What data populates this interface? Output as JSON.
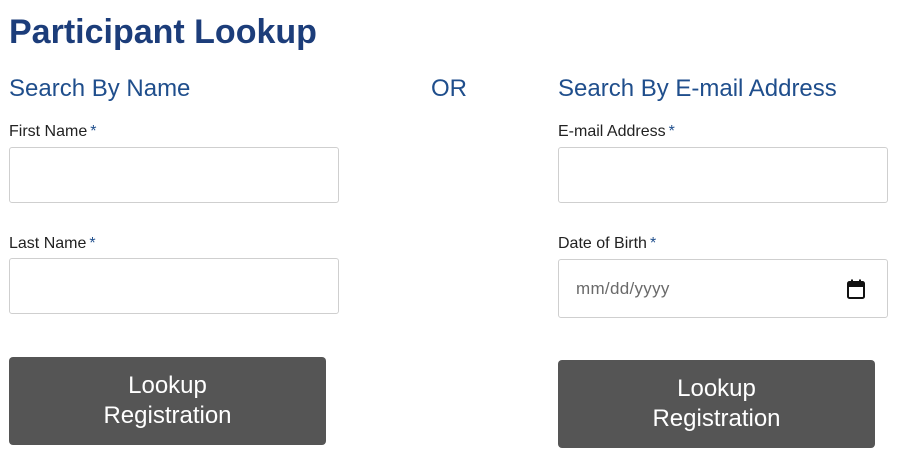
{
  "page": {
    "title": "Participant Lookup",
    "or_label": "OR"
  },
  "name_search": {
    "heading": "Search By Name",
    "first_name": {
      "label": "First Name",
      "required_marker": "*",
      "value": ""
    },
    "last_name": {
      "label": "Last Name",
      "required_marker": "*",
      "value": ""
    },
    "button_label": "Lookup Registration"
  },
  "email_search": {
    "heading": "Search By E-mail Address",
    "email": {
      "label": "E-mail Address",
      "required_marker": "*",
      "value": ""
    },
    "dob": {
      "label": "Date of Birth",
      "required_marker": "*",
      "placeholder": "mm/dd/yyyy",
      "icon": "calendar-icon"
    },
    "button_label": "Lookup Registration"
  },
  "colors": {
    "title": "#1c3d7a",
    "heading": "#1f4e8c",
    "button_bg": "#555555",
    "button_text": "#ffffff"
  }
}
